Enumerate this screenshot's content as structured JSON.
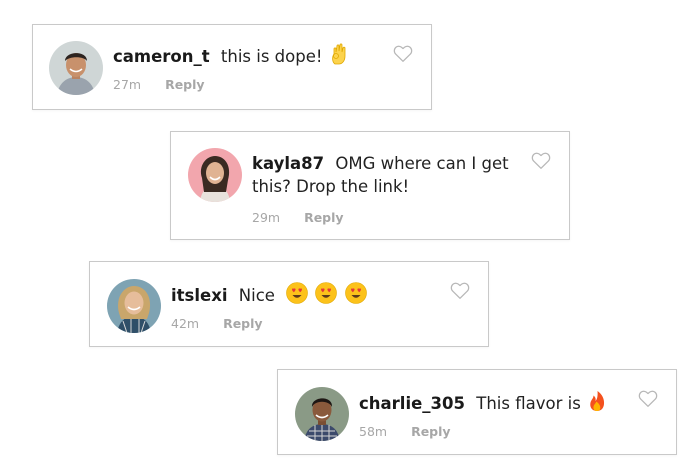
{
  "comments": [
    {
      "username": "cameron_t",
      "text": "this is dope!",
      "emoji": "ok-hand-emoji",
      "time": "27m",
      "reply_label": "Reply",
      "like_icon": "heart-outline-icon",
      "avatar_bg": "#cfd6d6"
    },
    {
      "username": "kayla87",
      "text": "OMG where can I get this? Drop the link!",
      "time": "29m",
      "reply_label": "Reply",
      "like_icon": "heart-outline-icon",
      "avatar_bg": "#f2a6ad"
    },
    {
      "username": "itslexi",
      "text": "Nice",
      "emoji": "heart-eyes-emoji ×3",
      "time": "42m",
      "reply_label": "Reply",
      "like_icon": "heart-outline-icon",
      "avatar_bg": "#7ea3b3"
    },
    {
      "username": "charlie_305",
      "text": "This flavor is",
      "emoji": "fire-emoji",
      "time": "58m",
      "reply_label": "Reply",
      "like_icon": "heart-outline-icon",
      "avatar_bg": "#8a9a86"
    }
  ],
  "colors": {
    "border": "#c9c9c9",
    "meta_text": "#a7a7a7",
    "heart_stroke": "#b7b7b7"
  }
}
